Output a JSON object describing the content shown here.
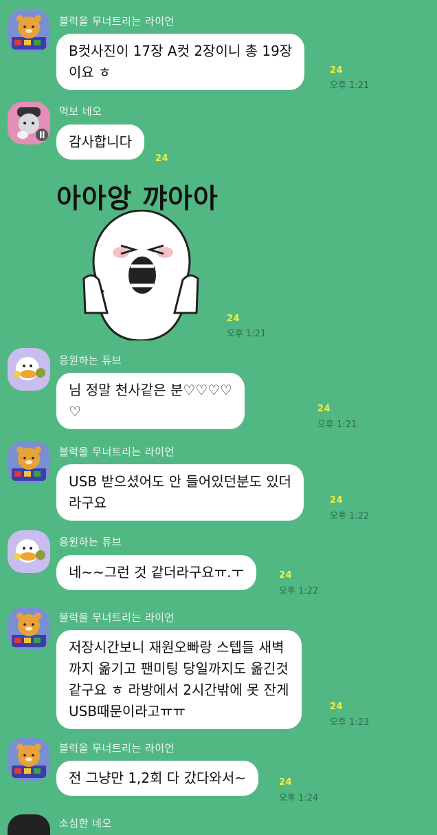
{
  "messages": [
    {
      "sender": "블럭을 무너트리는 라이언",
      "lines": [
        "B컷사진이 17장 A컷 2장이니 총 19장",
        "이요 ㅎ"
      ],
      "unread": "24",
      "time": "오후 1:21"
    },
    {
      "sender": "먹보 네오",
      "lines": [
        "감사합니다"
      ],
      "unread": "24"
    },
    {
      "sticker_text": "아아앙  꺄아아",
      "unread": "24",
      "time": "오후 1:21"
    },
    {
      "sender": "응원하는 튜브",
      "lines": [
        "님 정말 천사같은 분♡♡♡♡",
        "♡"
      ],
      "unread": "24",
      "time": "오후 1:21"
    },
    {
      "sender": "블럭을 무너트리는 라이언",
      "lines": [
        "USB 받으셨어도 안 들어있던분도 있더",
        "라구요"
      ],
      "unread": "24",
      "time": "오후 1:22"
    },
    {
      "sender": "응원하는 튜브",
      "lines": [
        "네~~그런 것 같더라구요ㅠ.ㅜ"
      ],
      "unread": "24",
      "time": "오후 1:22"
    },
    {
      "sender": "블럭을 무너트리는 라이언",
      "lines": [
        "저장시간보니 재원오빠랑 스텝들 새벽",
        "까지 옮기고 팬미팅 당일까지도 옮긴것",
        "같구요 ㅎ 라방에서 2시간밖에 못 잔게",
        "USB때문이라고ㅠㅠ"
      ],
      "unread": "24",
      "time": "오후 1:23"
    },
    {
      "sender": "블럭을 무너트리는 라이언",
      "lines": [
        "전 그냥만 1,2회 다 갔다와서~"
      ],
      "unread": "24",
      "time": "오후 1:24"
    },
    {
      "sender": "소심한 네오"
    }
  ]
}
